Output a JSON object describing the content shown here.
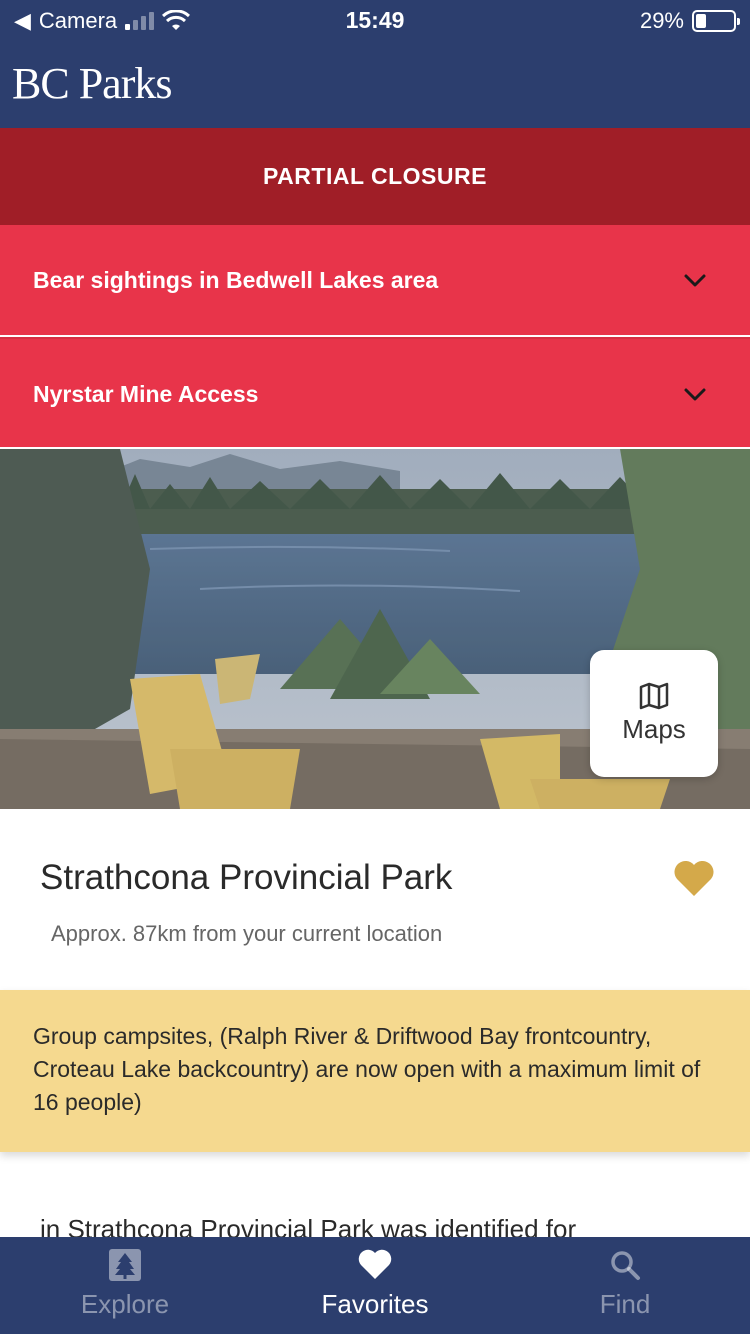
{
  "status_bar": {
    "back_app": "Camera",
    "time": "15:49",
    "battery_percent": "29%",
    "battery_level": 0.29
  },
  "header": {
    "logo_text": "BC Parks"
  },
  "closure": {
    "banner": "PARTIAL CLOSURE",
    "alerts": [
      {
        "label": "Bear sightings in Bedwell Lakes area"
      },
      {
        "label": "Nyrstar Mine Access"
      }
    ]
  },
  "hero": {
    "maps_label": "Maps"
  },
  "park": {
    "name": "Strathcona Provincial Park",
    "distance": "Approx. 87km from your current location",
    "favorited": true
  },
  "notice": {
    "text": "Group campsites, (Ralph River & Driftwood Bay frontcountry, Croteau Lake backcountry) are now open with a maximum limit of 16 people)"
  },
  "description": {
    "partial_text": "in Strathcona Provincial Park was identified for"
  },
  "bottom_nav": {
    "items": [
      {
        "label": "Explore",
        "icon": "tree-icon",
        "active": false
      },
      {
        "label": "Favorites",
        "icon": "heart-icon",
        "active": true
      },
      {
        "label": "Find",
        "icon": "search-icon",
        "active": false
      }
    ]
  },
  "colors": {
    "navy": "#2c3e6e",
    "closure_dark_red": "#a01e27",
    "alert_red": "#e8344a",
    "notice_yellow": "#f5d98f",
    "favorite_gold": "#d4a94a"
  }
}
